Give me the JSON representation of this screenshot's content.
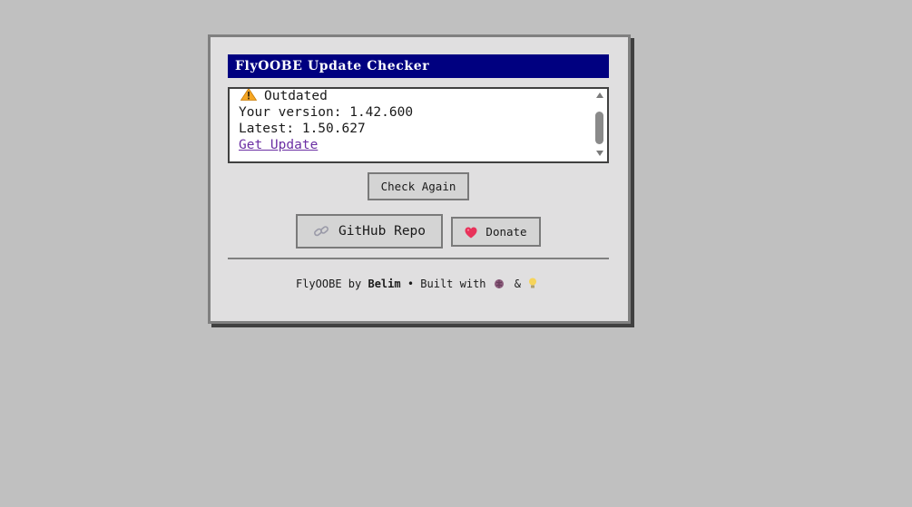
{
  "window": {
    "title": "FlyOOBE Update Checker"
  },
  "status": {
    "state_icon": "warning-icon",
    "state_label": "Outdated",
    "your_version": "Your version: 1.42.600",
    "latest_version": "Latest: 1.50.627",
    "update_link": "Get Update"
  },
  "buttons": {
    "check_again": "Check Again",
    "github": "GitHub Repo",
    "github_icon": "link-icon",
    "donate": "Donate",
    "donate_icon": "heart-icon"
  },
  "footer": {
    "prefix": "FlyOOBE by",
    "author": "Belim",
    "middle": "• Built with",
    "icon_1": "brain-icon",
    "amp": "&",
    "icon_2": "lightbulb-icon"
  },
  "colors": {
    "background": "#c0c0c0",
    "window": "#e0dfe0",
    "titlebar": "#000080",
    "link": "#6b2fa3",
    "warning": "#f5a623",
    "heart": "#e8325a"
  }
}
